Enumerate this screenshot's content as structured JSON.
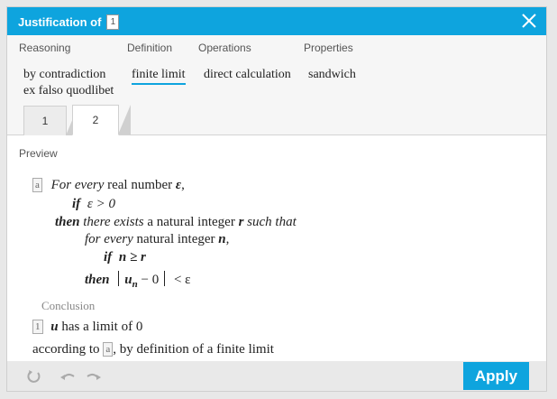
{
  "dialog": {
    "title": "Justification of",
    "title_ref": "1"
  },
  "categories": {
    "reasoning": {
      "header": "Reasoning",
      "items": [
        "by contradiction",
        "ex falso quodlibet"
      ]
    },
    "definition": {
      "header": "Definition",
      "items": [
        "finite limit"
      ]
    },
    "operations": {
      "header": "Operations",
      "items": [
        "direct calculation"
      ]
    },
    "properties": {
      "header": "Properties",
      "items": [
        "sandwich"
      ]
    }
  },
  "tabs": [
    "1",
    "2"
  ],
  "active_tab": "2",
  "preview": {
    "label": "Preview",
    "ref_a": "a",
    "line1_for_every": "For every",
    "line1_rest": "real number",
    "line1_var": "ε",
    "line1_comma": ",",
    "line2_if": "if",
    "line2_expr": "ε > 0",
    "line3_then": "then",
    "line3_exists": "there exists",
    "line3_mid": "a natural integer",
    "line3_var": "r",
    "line3_such": "such that",
    "line4_for_every": "for every",
    "line4_rest": "natural integer",
    "line4_var": "n",
    "line4_comma": ",",
    "line5_if": "if",
    "line5_expr": "n ≥ r",
    "line6_then": "then",
    "line6_u": "u",
    "line6_n": "n",
    "line6_minus": "− 0",
    "line6_lt": "< ε",
    "conclusion_label": "Conclusion",
    "conclusion_ref": "1",
    "conclusion_u": "u",
    "conclusion_text": "has a limit of 0",
    "according_prefix": "according to",
    "according_ref": "a",
    "according_suffix": ", by definition of a finite limit"
  },
  "footer": {
    "apply_label": "Apply",
    "icons": [
      "reset-icon",
      "undo-icon",
      "redo-icon"
    ]
  },
  "colors": {
    "accent": "#0ea4de"
  }
}
